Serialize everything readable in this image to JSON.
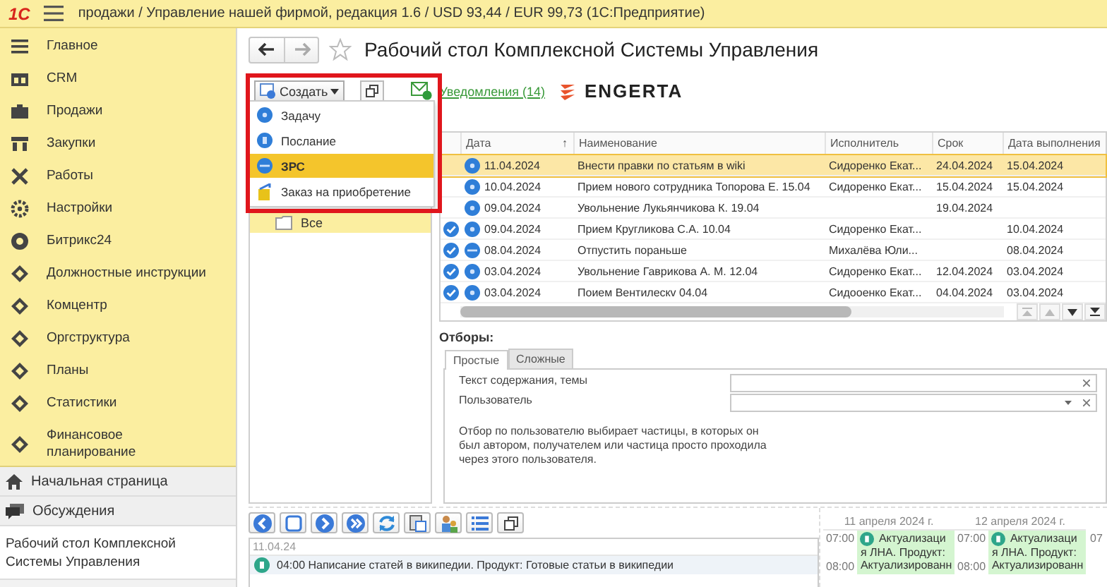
{
  "titlebar": {
    "logo": "1С",
    "title": "продажи / Управление нашей фирмой, редакция 1.6 / USD 93,44 / EUR 99,73  (1С:Предприятие)"
  },
  "sidebar": {
    "items": [
      {
        "label": "Главное"
      },
      {
        "label": "CRM"
      },
      {
        "label": "Продажи"
      },
      {
        "label": "Закупки"
      },
      {
        "label": "Работы"
      },
      {
        "label": "Настройки"
      },
      {
        "label": "Битрикс24"
      },
      {
        "label": "Должностные инструкции"
      },
      {
        "label": "Комцентр"
      },
      {
        "label": "Оргструктура"
      },
      {
        "label": "Планы"
      },
      {
        "label": "Статистики"
      },
      {
        "label": "Финансовое планирование"
      }
    ],
    "home": "Начальная страница",
    "discussions": "Обсуждения",
    "open_window": "Рабочий стол Комплексной Системы Управления"
  },
  "page": {
    "title": "Рабочий стол Комплексной Системы Управления"
  },
  "toolbar": {
    "create": "Создать",
    "notifications": "Уведомления (14)",
    "brand": "ENGERTA"
  },
  "create_menu": [
    {
      "kind": "task",
      "label": "Задачу",
      "selected": false
    },
    {
      "kind": "message",
      "label": "Послание",
      "selected": false
    },
    {
      "kind": "zrs",
      "label": "ЗРС",
      "selected": true
    },
    {
      "kind": "order",
      "label": "Заказ на приобретение",
      "selected": false
    }
  ],
  "tree": [
    {
      "label": "Все",
      "selected": true
    }
  ],
  "table": {
    "columns": [
      "Дата",
      "Наименование",
      "Исполнитель",
      "Срок",
      "Дата выполнения"
    ],
    "sort_mark": "↑",
    "rows": [
      {
        "done": false,
        "kind": "task",
        "selected": true,
        "date": "11.04.2024",
        "name": "Внести правки по статьям  в wiki",
        "executor": "Сидоренко Екат...",
        "due": "24.04.2024",
        "completed": "15.04.2024"
      },
      {
        "done": false,
        "kind": "task",
        "selected": false,
        "date": "10.04.2024",
        "name": "Прием нового сотрудника Топорова Е. 15.04",
        "executor": "Сидоренко Екат...",
        "due": "15.04.2024",
        "completed": "15.04.2024"
      },
      {
        "done": false,
        "kind": "task",
        "selected": false,
        "date": "09.04.2024",
        "name": "Увольнение Лукьянчикова К. 19.04",
        "executor": "",
        "due": "19.04.2024",
        "completed": ""
      },
      {
        "done": true,
        "kind": "task",
        "selected": false,
        "date": "09.04.2024",
        "name": "Прием Кругликова С.А. 10.04",
        "executor": "Сидоренко Екат...",
        "due": "",
        "completed": "10.04.2024"
      },
      {
        "done": true,
        "kind": "zrs",
        "selected": false,
        "date": "08.04.2024",
        "name": "Отпустить пораньше",
        "executor": "Михалёва Юли...",
        "due": "",
        "completed": "08.04.2024"
      },
      {
        "done": true,
        "kind": "task",
        "selected": false,
        "date": "03.04.2024",
        "name": "Увольнение Гаврикова А. М. 12.04",
        "executor": "Сидоренко Екат...",
        "due": "12.04.2024",
        "completed": "03.04.2024"
      },
      {
        "done": true,
        "kind": "task",
        "selected": false,
        "date": "03.04.2024",
        "name": "Поием Вентилескv 04.04",
        "executor": "Сидооенко Екат...",
        "due": "04.04.2024",
        "completed": "03.04.2024"
      }
    ]
  },
  "filters": {
    "title": "Отборы:",
    "tabs": [
      {
        "label": "Простые",
        "selected": true
      },
      {
        "label": "Сложные",
        "selected": false
      }
    ],
    "fields": [
      {
        "label": "Текст содержания, темы",
        "kind": "text"
      },
      {
        "label": "Пользователь",
        "kind": "select"
      }
    ],
    "hint": "Отбор по пользователю выбирает частицы, в которых он был автором, получателем или частица просто проходила через этого пользователя."
  },
  "feed": {
    "date": "11.04.24",
    "items": [
      {
        "text": "04:00 Написание статей в википедии. Продукт: Готовые статьи в википедии"
      }
    ]
  },
  "calendar": {
    "days": [
      {
        "date": "11 апреля 2024 г.",
        "times": [
          "07:00",
          "08:00"
        ],
        "event": [
          "Актуализаци",
          "я ЛНА. Продукт:",
          "Актуализированн"
        ]
      },
      {
        "date": "12 апреля 2024 г.",
        "times": [
          "07:00",
          "08:00"
        ],
        "event": [
          "Актуализаци",
          "я ЛНА. Продукт:",
          "Актуализированн"
        ]
      }
    ],
    "next_time": "07"
  }
}
